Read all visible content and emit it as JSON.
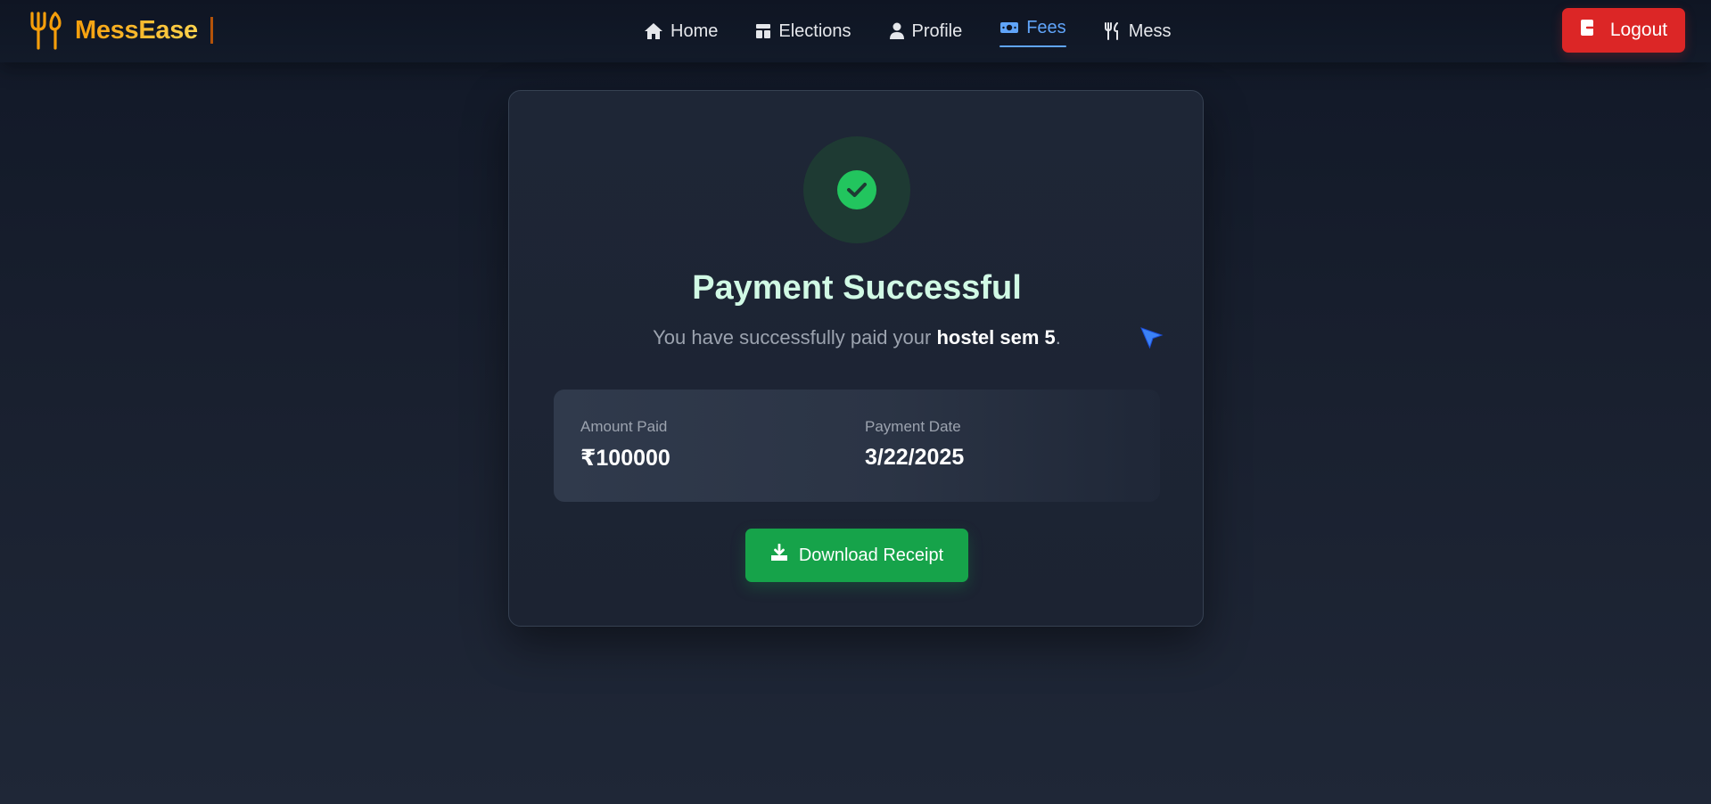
{
  "navbar": {
    "brand": "MessEase",
    "logo_icon": "fork-knife-icon",
    "links": [
      {
        "label": "Home",
        "icon": "home-icon",
        "active": false
      },
      {
        "label": "Elections",
        "icon": "elections-icon",
        "active": false
      },
      {
        "label": "Profile",
        "icon": "user-icon",
        "active": false
      },
      {
        "label": "Fees",
        "icon": "money-icon",
        "active": true
      },
      {
        "label": "Mess",
        "icon": "utensils-icon",
        "active": false
      }
    ],
    "logout_label": "Logout"
  },
  "payment": {
    "title": "Payment Successful",
    "subtitle_prefix": "You have successfully paid your ",
    "subtitle_item": "hostel sem 5",
    "subtitle_suffix": ".",
    "amount_label": "Amount Paid",
    "amount_value": "₹100000",
    "date_label": "Payment Date",
    "date_value": "3/22/2025",
    "download_label": "Download Receipt"
  },
  "colors": {
    "accent": "#60a5fa",
    "success": "#22c55e",
    "download_button": "#16a34a",
    "logout_button": "#dc2626",
    "brand": "#fbbf24"
  }
}
